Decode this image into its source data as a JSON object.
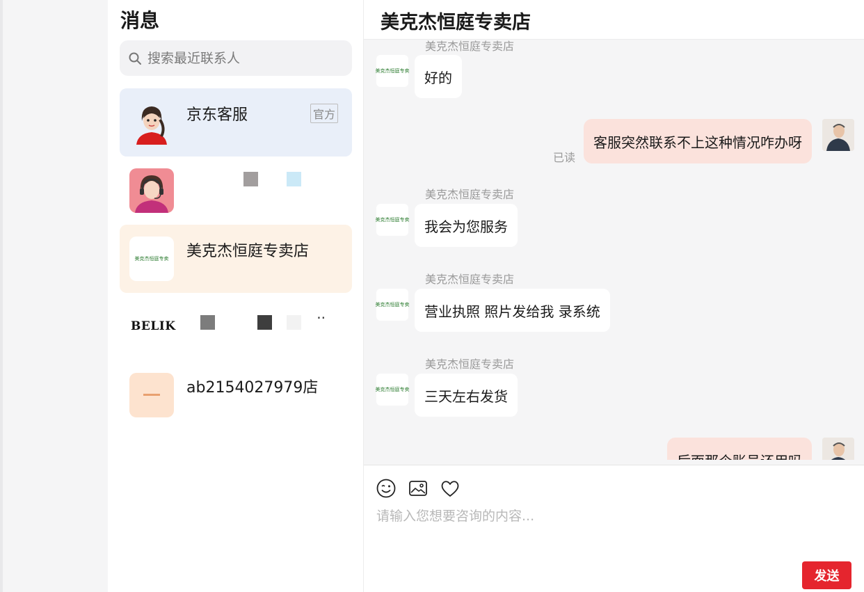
{
  "contacts_panel": {
    "title": "消息",
    "search_placeholder": "搜索最近联系人"
  },
  "contacts": [
    {
      "name": "京东客服",
      "badge": "官方"
    },
    {
      "name": ""
    },
    {
      "name": "美克杰恒庭专卖店",
      "avatar_text": "美克杰恒庭专卖"
    },
    {
      "name": "BELIK"
    },
    {
      "name": "ab2154027979店"
    }
  ],
  "chat": {
    "title": "美克杰恒庭专卖店",
    "read_label": "已读",
    "messages": [
      {
        "sender": "美克杰恒庭专卖店",
        "text": "好的"
      },
      {
        "from_me": true,
        "text": "客服突然联系不上这种情况咋办呀"
      },
      {
        "sender": "美克杰恒庭专卖店",
        "text": "我会为您服务"
      },
      {
        "sender": "美克杰恒庭专卖店",
        "text": "营业执照 照片发给我 录系统"
      },
      {
        "sender": "美克杰恒庭专卖店",
        "text": "三天左右发货"
      },
      {
        "from_me": true,
        "text": "后面那个账号还用吗"
      }
    ]
  },
  "composer": {
    "placeholder": "请输入您想要咨询的内容...",
    "send_label": "发送"
  },
  "colors": {
    "brand_red": "#e5252e",
    "outgoing_bubble": "#fbe2dc",
    "selected_contact": "#e9eff9",
    "highlight_contact": "#fdf2e6"
  }
}
